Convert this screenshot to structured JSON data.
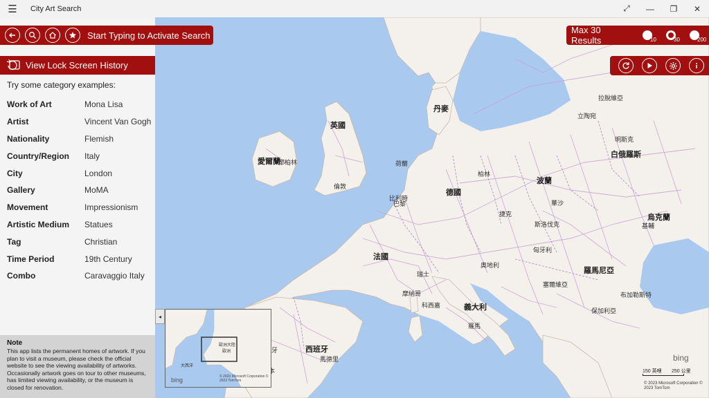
{
  "app": {
    "title": "City Art Search"
  },
  "window": {
    "expand_icon": "⤢",
    "minimize_icon": "—",
    "restore_icon": "❐",
    "close_icon": "✕"
  },
  "search": {
    "label": "Start Typing to Activate Search"
  },
  "history": {
    "label": "View Lock Screen History"
  },
  "examples": {
    "title": "Try some category examples:",
    "rows": [
      {
        "category": "Work of Art",
        "example": "Mona Lisa"
      },
      {
        "category": "Artist",
        "example": "Vincent Van Gogh"
      },
      {
        "category": "Nationality",
        "example": "Flemish"
      },
      {
        "category": "Country/Region",
        "example": "Italy"
      },
      {
        "category": "City",
        "example": "London"
      },
      {
        "category": "Gallery",
        "example": "MoMA"
      },
      {
        "category": "Movement",
        "example": "Impressionism"
      },
      {
        "category": "Artistic Medium",
        "example": "Statues"
      },
      {
        "category": "Tag",
        "example": "Christian"
      },
      {
        "category": "Time Period",
        "example": "19th Century"
      },
      {
        "category": "Combo",
        "example": "Caravaggio Italy"
      }
    ]
  },
  "note": {
    "title": "Note",
    "text": "This app lists the permanent homes of artwork. If you plan to visit a museum, please check the official website to see the viewing availability of artworks. Occasionally artwork goes on tour to other museums, has limited viewing availability, or the museum is closed for renovation."
  },
  "results": {
    "label": "Max 30 Results",
    "options": [
      {
        "value": "10",
        "selected": false
      },
      {
        "value": "30",
        "selected": true
      },
      {
        "value": "200",
        "selected": false
      }
    ]
  },
  "map": {
    "labels": [
      {
        "text": "英國",
        "big": true
      },
      {
        "text": "愛爾蘭",
        "big": true
      },
      {
        "text": "都柏林",
        "big": false
      },
      {
        "text": "丹麥",
        "big": true
      },
      {
        "text": "德國",
        "big": true
      },
      {
        "text": "波蘭",
        "big": true
      },
      {
        "text": "法國",
        "big": true
      },
      {
        "text": "巴黎",
        "big": false
      },
      {
        "text": "柏林",
        "big": false
      },
      {
        "text": "義大利",
        "big": true
      },
      {
        "text": "西班牙",
        "big": true
      },
      {
        "text": "羅馬尼亞",
        "big": true
      },
      {
        "text": "白俄羅斯",
        "big": true
      },
      {
        "text": "烏克蘭",
        "big": true
      },
      {
        "text": "拉脫維亞",
        "big": false
      },
      {
        "text": "立陶宛",
        "big": false
      },
      {
        "text": "捷克",
        "big": false
      },
      {
        "text": "匈牙利",
        "big": false
      },
      {
        "text": "倫敦",
        "big": false
      },
      {
        "text": "羅馬",
        "big": false
      },
      {
        "text": "馬德里",
        "big": false
      },
      {
        "text": "比利時",
        "big": false
      },
      {
        "text": "荷蘭",
        "big": false
      },
      {
        "text": "奧地利",
        "big": false
      },
      {
        "text": "布加勒斯特",
        "big": false
      },
      {
        "text": "保加利亞",
        "big": false
      },
      {
        "text": "塞爾維亞",
        "big": false
      },
      {
        "text": "斯洛伐克",
        "big": false
      },
      {
        "text": "華沙",
        "big": false
      },
      {
        "text": "明斯克",
        "big": false
      },
      {
        "text": "基輔",
        "big": false
      },
      {
        "text": "瑞士",
        "big": false
      },
      {
        "text": "葡萄牙",
        "big": false
      },
      {
        "text": "里斯本",
        "big": false
      },
      {
        "text": "摩納哥",
        "big": false
      },
      {
        "text": "科西嘉",
        "big": false
      }
    ],
    "minimap_labels": [
      "歐洲大陸",
      "歐洲",
      "大西洋"
    ],
    "minimap_copyright": "© 2023 Microsoft Corporation © 2023 TomTom",
    "copyright": "© 2023 Microsoft Corporation © 2023 TomTom",
    "scale_left": "150 英哩",
    "scale_right": "250 公里",
    "bing": "bing"
  },
  "colors": {
    "accent": "#a10f0f",
    "water": "#a9c9ee",
    "land": "#f4f1ec",
    "roads": "#c9a4d6"
  }
}
